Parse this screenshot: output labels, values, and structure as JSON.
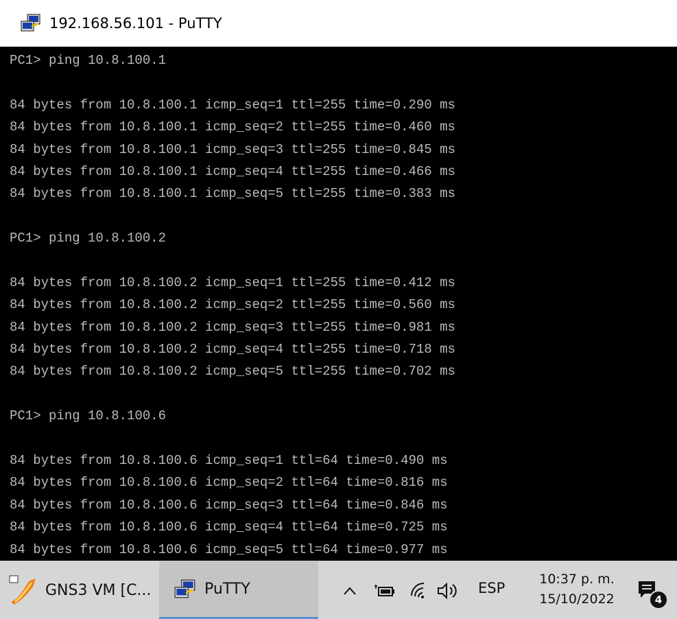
{
  "window": {
    "title": "192.168.56.101 - PuTTY",
    "icon": "putty-icon"
  },
  "terminal": {
    "lines": [
      "PC1> ping 10.8.100.1",
      "",
      "84 bytes from 10.8.100.1 icmp_seq=1 ttl=255 time=0.290 ms",
      "84 bytes from 10.8.100.1 icmp_seq=2 ttl=255 time=0.460 ms",
      "84 bytes from 10.8.100.1 icmp_seq=3 ttl=255 time=0.845 ms",
      "84 bytes from 10.8.100.1 icmp_seq=4 ttl=255 time=0.466 ms",
      "84 bytes from 10.8.100.1 icmp_seq=5 ttl=255 time=0.383 ms",
      "",
      "PC1> ping 10.8.100.2",
      "",
      "84 bytes from 10.8.100.2 icmp_seq=1 ttl=255 time=0.412 ms",
      "84 bytes from 10.8.100.2 icmp_seq=2 ttl=255 time=0.560 ms",
      "84 bytes from 10.8.100.2 icmp_seq=3 ttl=255 time=0.981 ms",
      "84 bytes from 10.8.100.2 icmp_seq=4 ttl=255 time=0.718 ms",
      "84 bytes from 10.8.100.2 icmp_seq=5 ttl=255 time=0.702 ms",
      "",
      "PC1> ping 10.8.100.6",
      "",
      "84 bytes from 10.8.100.6 icmp_seq=1 ttl=64 time=0.490 ms",
      "84 bytes from 10.8.100.6 icmp_seq=2 ttl=64 time=0.816 ms",
      "84 bytes from 10.8.100.6 icmp_seq=3 ttl=64 time=0.846 ms",
      "84 bytes from 10.8.100.6 icmp_seq=4 ttl=64 time=0.725 ms",
      "84 bytes from 10.8.100.6 icmp_seq=5 ttl=64 time=0.977 ms"
    ]
  },
  "taskbar": {
    "apps": [
      {
        "label": "GNS3 VM [C...",
        "icon": "gns3-icon"
      },
      {
        "label": "PuTTY",
        "icon": "putty-icon",
        "active": true
      }
    ],
    "tray": {
      "chevron_icon": "chevron-up-icon",
      "battery_icon": "battery-icon",
      "wifi_icon": "wifi-icon",
      "volume_icon": "volume-icon",
      "language": "ESP",
      "time": "10:37 p. m.",
      "date": "15/10/2022",
      "notification_icon": "notification-icon",
      "notification_count": "4"
    }
  },
  "colors": {
    "terminal_bg": "#000000",
    "terminal_fg": "#bbbbbb",
    "taskbar_bg": "#d6d6d6",
    "active_underline": "#5a8fd6"
  }
}
